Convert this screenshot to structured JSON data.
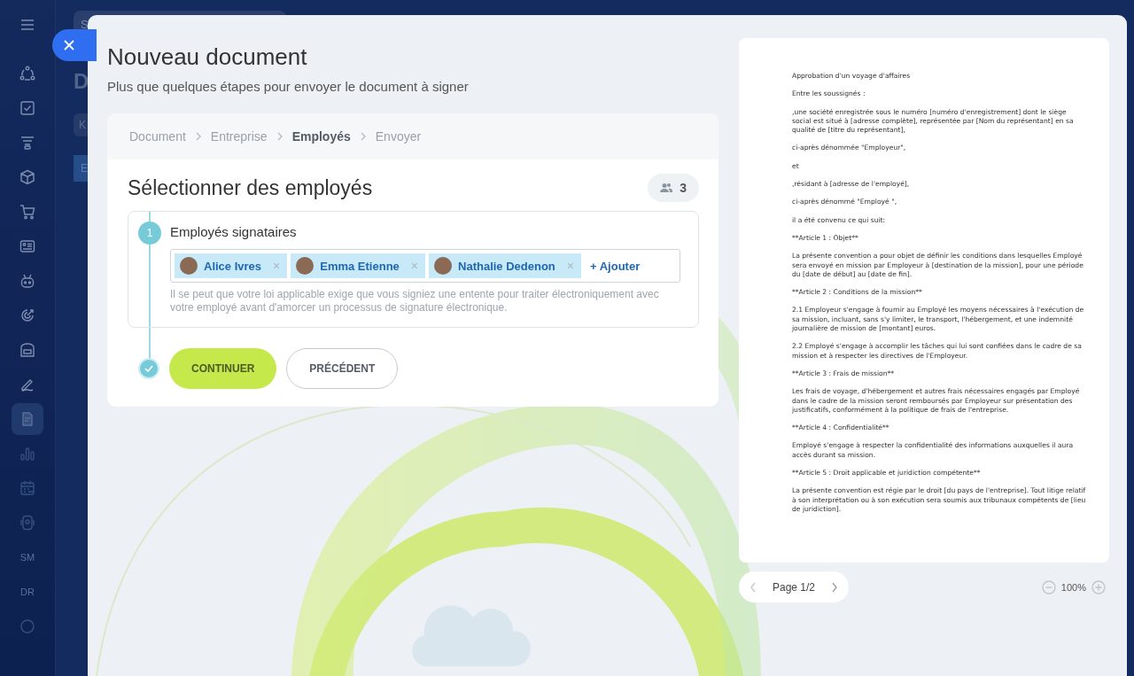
{
  "sidebar": {
    "items": [
      {
        "kind": "menu",
        "selected": false
      },
      {
        "kind": "flow",
        "selected": false
      },
      {
        "kind": "task",
        "selected": false
      },
      {
        "kind": "funnel",
        "selected": false
      },
      {
        "kind": "box",
        "selected": false
      },
      {
        "kind": "cart",
        "selected": false
      },
      {
        "kind": "card",
        "selected": false
      },
      {
        "kind": "robot",
        "selected": false
      },
      {
        "kind": "target",
        "selected": false
      },
      {
        "kind": "store",
        "selected": false
      },
      {
        "kind": "pen",
        "selected": false
      },
      {
        "kind": "document",
        "selected": true
      },
      {
        "kind": "chart",
        "selected": false
      },
      {
        "kind": "calendar",
        "selected": false
      },
      {
        "kind": "phone",
        "selected": false
      },
      {
        "kind": "initials",
        "label": "SM",
        "selected": false
      },
      {
        "kind": "initials",
        "label": "DR",
        "selected": false
      },
      {
        "kind": "circle",
        "selected": false
      }
    ]
  },
  "background_page": {
    "search_letter": "S",
    "heading_letter": "D",
    "filter_letter": "K",
    "button_letter": "E"
  },
  "modal": {
    "title": "Nouveau document",
    "subtitle": "Plus que quelques étapes pour envoyer le document à signer",
    "steps": [
      {
        "label": "Document",
        "selected": false
      },
      {
        "label": "Entreprise",
        "selected": false
      },
      {
        "label": "Employés",
        "selected": true
      },
      {
        "label": "Envoyer",
        "selected": false
      }
    ],
    "section_title": "Sélectionner des employés",
    "employee_count": "3",
    "signers": {
      "step_number": "1",
      "title": "Employés signataires",
      "chips": [
        {
          "name": "Alice Ivres",
          "remove": "×"
        },
        {
          "name": "Emma Etienne",
          "remove": "×"
        },
        {
          "name": "Nathalie Dedenon",
          "remove": "×"
        }
      ],
      "add_label": "+ Ajouter",
      "hint": "Il se peut que votre loi applicable exige que vous signiez une entente pour traiter électroniquement avec votre employé avant d'amorcer un processus de signature électronique."
    },
    "buttons": [
      {
        "kind": "primary",
        "label": "CONTINUER"
      },
      {
        "kind": "secondary",
        "label": "PRÉCÉDENT"
      }
    ]
  },
  "preview": {
    "paragraphs": [
      "Approbation d'un voyage d'affaires",
      "Entre les soussignés :",
      " ,une société enregistrée sous le numéro [numéro d'enregistrement] dont le siège social est situé à [adresse complète], représentée par [Nom du représentant] en sa qualité de [titre du représentant],",
      "ci-après dénommée \"Employeur\",",
      "et",
      " ,résidant à [adresse de l'employé],",
      "ci-après dénommé \"Employé \",",
      "il a été convenu ce qui suit:",
      "**Article 1 : Objet**",
      "La présente convention a pour objet de définir les conditions dans lesquelles Employé sera envoyé en mission par Employeur à [destination de la mission], pour une période du [date de début] au [date de fin].",
      "**Article 2 : Conditions de la mission**",
      "2.1 Employeur s'engage à fournir au Employé les moyens nécessaires à l'exécution de sa mission, incluant, sans s'y limiter, le transport, l'hébergement, et une indemnité journalière de mission de [montant] euros.",
      "2.2 Employé s'engage à accomplir les tâches qui lui sont confiées dans le cadre de sa mission et à respecter les directives de l'Employeur.",
      "**Article 3 : Frais de mission**",
      "Les frais de voyage, d'hébergement et autres frais nécessaires engagés par Employé dans le cadre de la mission seront remboursés par Employeur sur présentation des justificatifs, conformément à la politique de frais de l'entreprise.",
      "**Article 4 : Confidentialité**",
      "Employé s'engage à respecter la confidentialité des informations auxquelles il aura accès durant sa mission.",
      "**Article 5 : Droit applicable et juridiction compétente**",
      "La présente convention est régie par le droit [du pays de l'entreprise]. Tout litige relatif à son interprétation ou à son exécution sera soumis aux tribunaux compétents de [lieu de juridiction]."
    ],
    "page_label": "Page 1/2",
    "zoom": "100%"
  }
}
